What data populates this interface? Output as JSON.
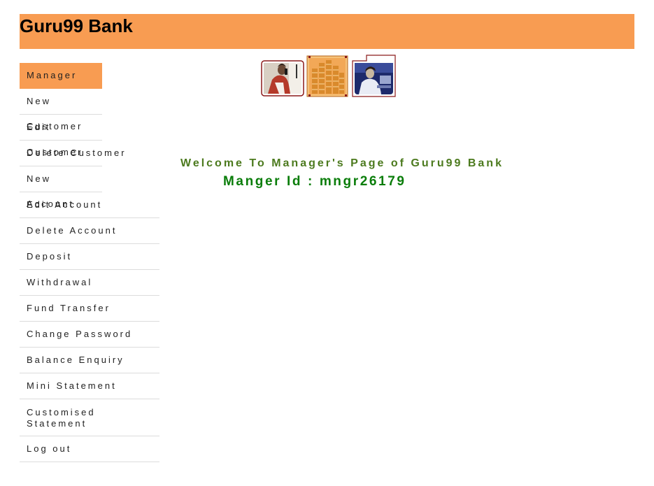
{
  "header": {
    "title": "Guru99 Bank",
    "bg_color": "#f89c52"
  },
  "menu": {
    "items": [
      {
        "label": "Manager"
      },
      {
        "label": "New Customer"
      },
      {
        "label": "Edit Customer"
      },
      {
        "label": "Delete Customer"
      },
      {
        "label": "New Account"
      },
      {
        "label": "Edit Account"
      },
      {
        "label": "Delete Account"
      },
      {
        "label": "Deposit"
      },
      {
        "label": "Withdrawal"
      },
      {
        "label": "Fund Transfer"
      },
      {
        "label": "Change Password"
      },
      {
        "label": "Balance Enquiry"
      },
      {
        "label": "Mini Statement"
      },
      {
        "label": "Customised Statement"
      },
      {
        "label": "Log out"
      }
    ]
  },
  "main": {
    "welcome_text": "Welcome To Manager's Page of Guru99 Bank",
    "manager_id_text": "Manger Id : mngr26179",
    "welcome_color": "#4c7a1e",
    "manager_id_color": "#0a7d0a"
  },
  "banner": {
    "images": [
      "man-on-phone-photo",
      "coin-stacks-photo",
      "woman-at-computer-photo"
    ]
  }
}
